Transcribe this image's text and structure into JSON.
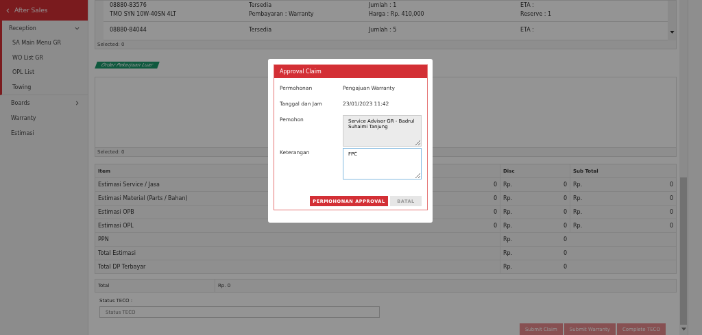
{
  "sidebar": {
    "header": {
      "label": "After Sales"
    },
    "items": [
      {
        "label": "Reception",
        "expanded": true,
        "children": [
          {
            "label": "SA Main Menu GR"
          },
          {
            "label": "WO List GR"
          },
          {
            "label": "OPL List"
          },
          {
            "label": "Towing"
          }
        ]
      },
      {
        "label": "Boards",
        "expanded": false
      },
      {
        "label": "Warranty"
      },
      {
        "label": "Estimasi"
      }
    ]
  },
  "parts_table": {
    "rows": [
      {
        "lines": [
          [
            "08880-83576",
            "Tersedia",
            "Jumlah : 1",
            "ETA :"
          ],
          [
            "TMO SYN 10W-40SN 4LT",
            "Pembayaran : Warranty",
            "Harga : Rp. 410,000",
            "Reserve : 1"
          ]
        ]
      },
      {
        "lines": [
          [
            "08880-84044",
            "Tersedia",
            "Jumlah : 5",
            "ETA :"
          ]
        ]
      }
    ],
    "selected_text": "Selected: 0"
  },
  "opl": {
    "tag": "Order Pekerjaan Luar",
    "selected_text": "Selected: 0"
  },
  "estimate_table": {
    "columns": [
      "Item",
      "",
      "Disc",
      "Sub Total"
    ],
    "rows": [
      {
        "label": "Estimasi Service / Jasa",
        "amount": "0",
        "disc_currency": "Rp.",
        "disc": "0",
        "subtotal_currency": "Rp.",
        "subtotal": "0"
      },
      {
        "label": "Estimasi Material (Parts / Bahan)",
        "amount": "0",
        "disc_currency": "Rp.",
        "disc": "0",
        "subtotal_currency": "Rp.",
        "subtotal": "0"
      },
      {
        "label": "Estimasi OPB",
        "amount": "0",
        "disc_currency": "Rp.",
        "disc": "0",
        "subtotal_currency": "Rp.",
        "subtotal": "0"
      },
      {
        "label": "Estimasi OPL",
        "amount": "0",
        "disc_currency": "Rp.",
        "disc": "0",
        "subtotal_currency": "Rp.",
        "subtotal": "0"
      },
      {
        "label": "PPN",
        "subtotal_currency": "Rp.",
        "subtotal": "0"
      },
      {
        "label": "Total Estimasi",
        "subtotal_currency": "Rp.",
        "subtotal": "0"
      },
      {
        "label": "Total DP Terbayar",
        "subtotal_currency": "Rp.",
        "subtotal": "0"
      }
    ]
  },
  "total": {
    "label": "Total",
    "value": "Rp. 0"
  },
  "status_teco": {
    "label": "Status TECO :",
    "placeholder": "Status TECO"
  },
  "actions": [
    {
      "label": "Submit Claim",
      "disabled": true
    },
    {
      "label": "Submit Warranty",
      "disabled": true
    },
    {
      "label": "Complete TECO",
      "disabled": true
    }
  ],
  "modal": {
    "title": "Approval Claim",
    "fields": [
      {
        "label": "Permohonan",
        "kind": "text",
        "value": "Pengajuan Warranty"
      },
      {
        "label": "Tanggal dan Jam",
        "kind": "text",
        "value": "23/01/2023 11:42"
      },
      {
        "label": "Pemohon",
        "kind": "textarea",
        "value": "Service Advisor GR - Badrul Suhaimi Tanjung",
        "readonly": true
      },
      {
        "label": "Keterangan",
        "kind": "textarea",
        "value": "FPC",
        "readonly": false
      }
    ],
    "buttons": [
      {
        "label": "PERMOHONAN APPROVAL",
        "kind": "primary"
      },
      {
        "label": "BATAL",
        "kind": "secondary"
      }
    ]
  }
}
